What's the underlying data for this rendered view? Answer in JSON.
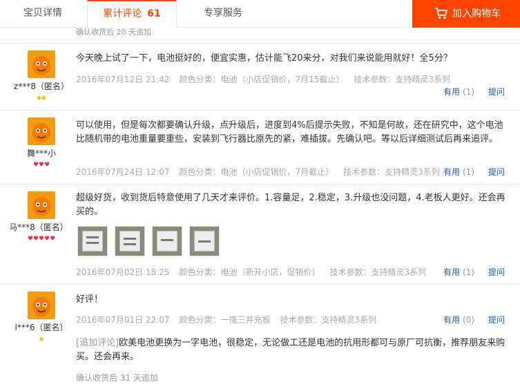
{
  "tabs": [
    {
      "label": "宝贝详情"
    },
    {
      "label": "累计评论",
      "count": "61"
    },
    {
      "label": "专享服务"
    }
  ],
  "cart": {
    "label": "加入购物车",
    "icon": "cart-icon"
  },
  "top_meta": "确认收货后 20 天追加",
  "reviews": [
    {
      "user": "z***8（匿名）",
      "badge": "◆◆",
      "text": "今天晚上试了一下，电池挺好的，便宜实惠，估计能飞20来分，对我们来说能用就好！全5分？",
      "date": "2016年07月12日 21:42",
      "color": "颜色分类：电池（小店促销价，7月15截止）",
      "tech": "技术参数：支持精灵3系列",
      "useful": "有用",
      "useful_count": "(1)",
      "ask": "提问"
    },
    {
      "user": "舞***小",
      "badge": "♥♥♥",
      "text": "可以使用，但是每次都要确认升级，点升级后，进度到4%后提示失败，不知是何故，还在研究中，这个电池比随机带的电池重量要重些，安装到飞行器比原先的紧，难插拔。先确认吧。等以后详细测试后再来追评。",
      "date": "2016年07月24日 12:07",
      "color": "颜色分类：电池（小店促销价，7月截止）",
      "tech": "技术参数：支持精灵3系列",
      "useful": "有用",
      "useful_count": "(1)",
      "ask": "提问"
    },
    {
      "user": "马***8（匿名）",
      "badge": "♥♥♥♥♥",
      "text": "超级好货，收到货后特意使用了几天才来评价。1.容量足，2.稳定，3.升级也没问题，4.老板人更好。还会再买的。",
      "date": "2016年07月02日 18:25",
      "color": "颜色分类：电池（新开小店，促销价）",
      "tech": "技术参数：支持精灵3系列",
      "useful": "有用",
      "useful_count": "(1)",
      "ask": "提问"
    },
    {
      "user": "l***6（匿名）",
      "badge": "◆",
      "text": "好评！",
      "date": "2016年07月01日 22:07",
      "color": "颜色分类：一拖三并充板",
      "tech": "技术参数：支持精灵3系列",
      "useful": "有用",
      "useful_count": "(0)",
      "ask": "提问",
      "append_tag": "[追加评论]",
      "append_text": "欧美电池更换为一字电池，很稳定，无论做工还是电池的抗用形都可与原厂可抗衡，推荐朋友来购买。还会再来。",
      "append_meta": "确认收货后 31 天追加"
    }
  ],
  "colors": {
    "accent": "#ff4400",
    "link": "#1e5ea8",
    "meta": "#aaaaaa"
  }
}
